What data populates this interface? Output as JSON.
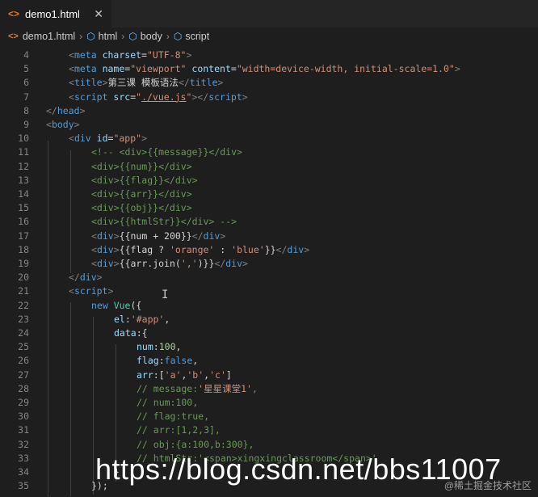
{
  "tab": {
    "icon": "<>",
    "label": "demo1.html",
    "close": "✕"
  },
  "breadcrumb": [
    {
      "label": "demo1.html",
      "icon": "html-file-icon"
    },
    {
      "label": "html",
      "icon": "cube-icon"
    },
    {
      "label": "body",
      "icon": "cube-icon"
    },
    {
      "label": "script",
      "icon": "cube-icon"
    }
  ],
  "line_numbers": [
    "4",
    "5",
    "6",
    "7",
    "8",
    "9",
    "10",
    "11",
    "12",
    "13",
    "14",
    "15",
    "16",
    "17",
    "18",
    "19",
    "20",
    "21",
    "22",
    "23",
    "24",
    "25",
    "26",
    "27",
    "28",
    "29",
    "30",
    "31",
    "32",
    "33",
    "34",
    "35"
  ],
  "code": {
    "l4": {
      "open": "<",
      "tag": "meta",
      "attr": "charset",
      "eq": "=",
      "val": "\"UTF-8\"",
      "close": ">"
    },
    "l5": {
      "open": "<",
      "tag": "meta",
      "attr1": "name",
      "eq": "=",
      "val1": "\"viewport\"",
      "attr2": "content",
      "val2": "\"width=device-width, initial-scale=1.0\"",
      "close": ">"
    },
    "l6": {
      "open": "<",
      "tag": "title",
      "gt": ">",
      "text": "第三课 模板语法",
      "open2": "</",
      "close": ">"
    },
    "l7": {
      "open": "<",
      "tag": "script",
      "attr": "src",
      "eq": "=",
      "q1": "\"",
      "val": "./vue.js",
      "q2": "\"",
      "gt": ">",
      "open2": "</",
      "close": ">"
    },
    "l8": {
      "open": "</",
      "tag": "head",
      "close": ">"
    },
    "l9": {
      "open": "<",
      "tag": "body",
      "close": ">"
    },
    "l10": {
      "open": "<",
      "tag": "div",
      "attr": "id",
      "eq": "=",
      "val": "\"app\"",
      "close": ">"
    },
    "l11": "<!-- <div>{{message}}</div>",
    "l12": "<div>{{num}}</div>",
    "l13": "<div>{{flag}}</div>",
    "l14": "<div>{{arr}}</div>",
    "l15": "<div>{{obj}}</div>",
    "l16": "<div>{{htmlStr}}</div> -->",
    "l17": {
      "open": "<",
      "tag": "div",
      "gt": ">",
      "expr": "{{num + 200}}",
      "open2": "</",
      "close": ">"
    },
    "l18": {
      "open": "<",
      "tag": "div",
      "gt": ">",
      "e1": "{{flag ? ",
      "s1": "'orange'",
      "e2": " : ",
      "s2": "'blue'",
      "e3": "}}",
      "open2": "</",
      "close": ">"
    },
    "l19": {
      "open": "<",
      "tag": "div",
      "gt": ">",
      "e1": "{{arr.join(",
      "s1": "','",
      "e2": ")}}",
      "open2": "</",
      "close": ">"
    },
    "l20": {
      "open": "</",
      "tag": "div",
      "close": ">"
    },
    "l21": {
      "open": "<",
      "tag": "script",
      "close": ">"
    },
    "l22": {
      "kw": "new",
      "cls": " Vue",
      "rest": "({"
    },
    "l23": {
      "key": "el",
      "colon": ":",
      "val": "'#app'",
      "comma": ","
    },
    "l24": {
      "key": "data",
      "rest": ":{"
    },
    "l25": {
      "key": "num",
      "colon": ":",
      "val": "100",
      "comma": ","
    },
    "l26": {
      "key": "flag",
      "colon": ":",
      "val": "false",
      "comma": ","
    },
    "l27": {
      "key": "arr",
      "colon": ":",
      "b1": "[",
      "v1": "'a'",
      "c1": ",",
      "v2": "'b'",
      "c2": ",",
      "v3": "'c'",
      "b2": "]"
    },
    "l28": {
      "pre": "// message:",
      "str": "'星星课堂1'",
      "post": ","
    },
    "l29": "// num:100,",
    "l30": "// flag:true,",
    "l31": "// arr:[1,2,3],",
    "l32": "// obj:{a:100,b:300},",
    "l33": "// htmlStr:'<span>xingxingclassroom</span>'",
    "l34": "}",
    "l35": "});"
  },
  "watermark": "https://blog.csdn.net/bbs11007",
  "corner_mark": "@稀土掘金技术社区"
}
